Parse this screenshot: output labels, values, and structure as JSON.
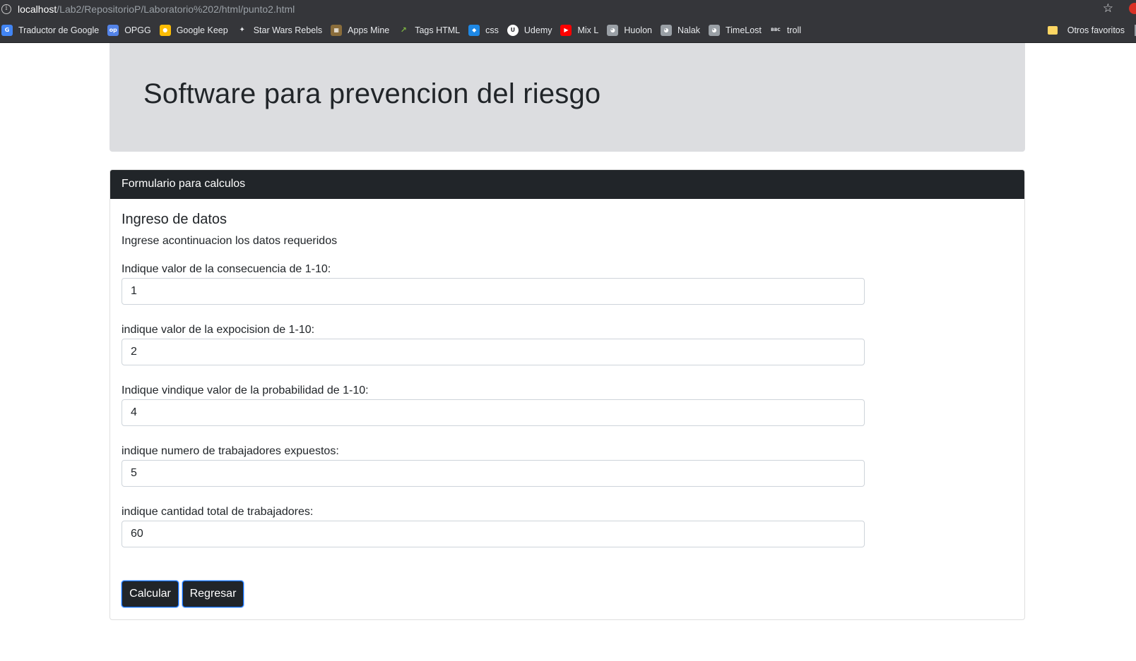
{
  "browser": {
    "url_host": "localhost",
    "url_path": "/Lab2/RepositorioP/Laboratorio%202/html/punto2.html",
    "bookmarks": [
      {
        "label": "Traductor de Google",
        "icon": "google-translate-icon",
        "color": "#4285f4"
      },
      {
        "label": "OPGG",
        "icon": "opgg-icon",
        "color": "#5383e8"
      },
      {
        "label": "Google Keep",
        "icon": "google-keep-icon",
        "color": "#fbbc04"
      },
      {
        "label": "Star Wars Rebels",
        "icon": "star-wars-icon",
        "color": "#35363a"
      },
      {
        "label": "Apps Mine",
        "icon": "apps-mine-icon",
        "color": "#8a6d3b"
      },
      {
        "label": "Tags HTML",
        "icon": "chart-icon",
        "color": "#35363a"
      },
      {
        "label": "css",
        "icon": "css-icon",
        "color": "#1e88e5"
      },
      {
        "label": "Udemy",
        "icon": "udemy-icon",
        "color": "#ffffff"
      },
      {
        "label": "Mix L",
        "icon": "youtube-icon",
        "color": "#ff0000"
      },
      {
        "label": "Huolon",
        "icon": "cat-icon",
        "color": "#9aa0a6"
      },
      {
        "label": "Nalak",
        "icon": "cat-icon",
        "color": "#9aa0a6"
      },
      {
        "label": "TimeLost",
        "icon": "cat-icon",
        "color": "#9aa0a6"
      },
      {
        "label": "troll",
        "icon": "bbc-icon",
        "color": "#35363a"
      }
    ],
    "other_bookmarks": "Otros favoritos"
  },
  "jumbotron": {
    "title": "Software para prevencion del riesgo"
  },
  "card": {
    "header": "Formulario para calculos",
    "title": "Ingreso de datos",
    "text": "Ingrese acontinuacion los datos requeridos",
    "fields": [
      {
        "label": "Indique valor de la consecuencia de 1-10:",
        "value": "1"
      },
      {
        "label": "indique valor de la expocision de 1-10:",
        "value": "2"
      },
      {
        "label": "Indique vindique valor de la probabilidad de 1-10:",
        "value": "4"
      },
      {
        "label": "indique numero de trabajadores expuestos:",
        "value": "5"
      },
      {
        "label": "indique cantidad total de trabajadores:",
        "value": "60"
      }
    ],
    "buttons": {
      "calcular": "Calcular",
      "regresar": "Regresar"
    }
  },
  "colors": {
    "dark": "#212529",
    "jumbotron_bg": "#dcdde0",
    "focus_border": "#0d6efd"
  }
}
